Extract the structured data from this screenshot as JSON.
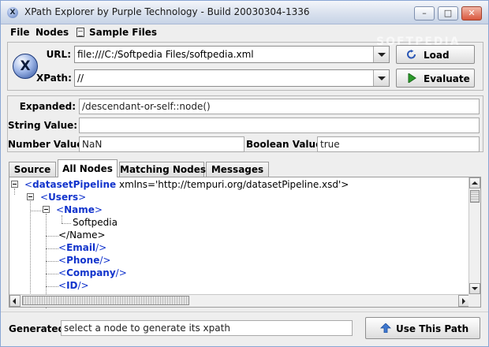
{
  "window": {
    "title": "XPath Explorer by Purple Technology - Build 20030304-1336",
    "app_icon_glyph": "X",
    "controls": {
      "minimize": "–",
      "maximize": "□",
      "close": "✕"
    }
  },
  "menu": {
    "file": "File",
    "nodes": "Nodes",
    "sample_files": "Sample Files"
  },
  "query": {
    "logo_glyph": "X",
    "url_label": "URL:",
    "url_value": "file:///C:/Softpedia Files/softpedia.xml",
    "xpath_label": "XPath:",
    "xpath_value": "//",
    "load_label": "Load",
    "evaluate_label": "Evaluate"
  },
  "results": {
    "expanded_label": "Expanded:",
    "expanded_value": "/descendant-or-self::node()",
    "string_label": "String Value:",
    "string_value": "",
    "number_label": "Number Value:",
    "number_value": "NaN",
    "boolean_label": "Boolean Value:",
    "boolean_value": "true"
  },
  "tabs": {
    "source": "Source",
    "all_nodes": "All Nodes",
    "matching_nodes": "Matching Nodes",
    "messages": "Messages",
    "active": "All Nodes"
  },
  "tree": {
    "dataset_open": "<",
    "dataset_name": "datasetPipeline",
    "dataset_attr": " xmlns='http://tempuri.org/datasetPipeline.xsd'>",
    "users_open": "<",
    "users_name": "Users",
    "users_close": ">",
    "name_open": "<",
    "name_name": "Name",
    "name_close": ">",
    "name_text": "Softpedia",
    "name_end": "</Name>",
    "email_open": "<",
    "email_name": "Email",
    "email_close": "/>",
    "phone_open": "<",
    "phone_name": "Phone",
    "phone_close": "/>",
    "company_open": "<",
    "company_name": "Company",
    "company_close": "/>",
    "id_open": "<",
    "id_name": "ID",
    "id_close": "/>"
  },
  "bottom": {
    "generated_label": "Generated:",
    "generated_value": "select a node to generate its xpath",
    "use_path_label": "Use This Path"
  },
  "watermark": "SOFTPEDIA",
  "colors": {
    "tag_blue": "#1234cc",
    "tab_active": "#ffffff",
    "window_bg": "#eeeeee"
  }
}
